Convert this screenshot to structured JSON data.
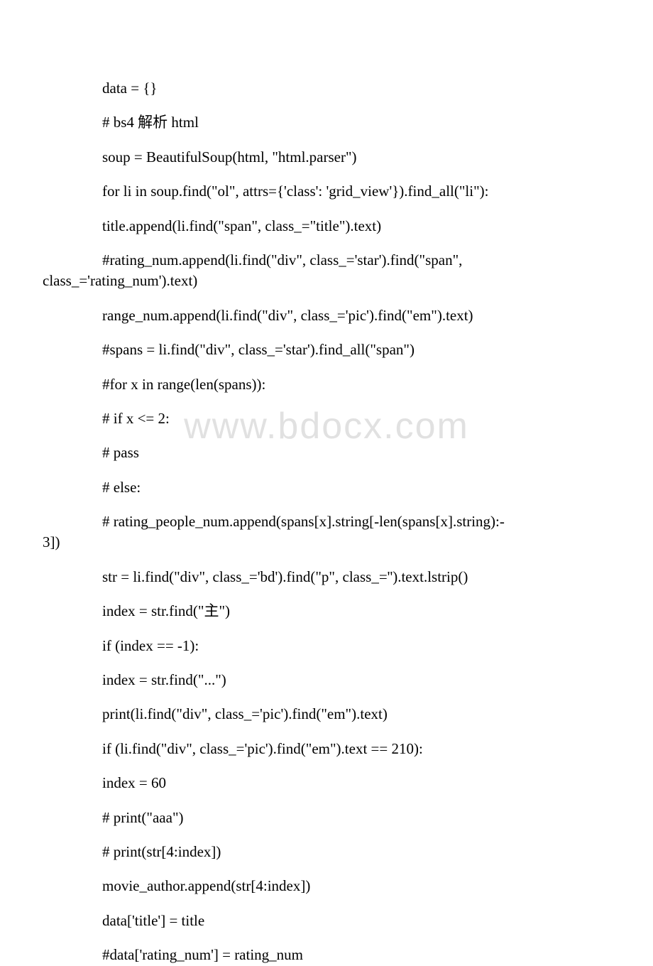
{
  "watermark": "www.bdocx.com",
  "lines": [
    {
      "text": "data = {}",
      "indent": true
    },
    {
      "text": "# bs4 解析 html",
      "indent": true
    },
    {
      "text": "soup = BeautifulSoup(html, \"html.parser\")",
      "indent": true
    },
    {
      "text": "for li in soup.find(\"ol\", attrs={'class': 'grid_view'}).find_all(\"li\"):",
      "indent": true
    },
    {
      "text": "title.append(li.find(\"span\", class_=\"title\").text)",
      "indent": true
    },
    {
      "text": "#rating_num.append(li.find(\"div\", class_='star').find(\"span\", class_='rating_num').text)",
      "indent": true,
      "wrap": true
    },
    {
      "text": "range_num.append(li.find(\"div\", class_='pic').find(\"em\").text)",
      "indent": true
    },
    {
      "text": "#spans = li.find(\"div\", class_='star').find_all(\"span\")",
      "indent": true
    },
    {
      "text": "#for x in range(len(spans)):",
      "indent": true
    },
    {
      "text": "# if x <= 2:",
      "indent": true
    },
    {
      "text": "# pass",
      "indent": true
    },
    {
      "text": "# else:",
      "indent": true
    },
    {
      "text": "# rating_people_num.append(spans[x].string[-len(spans[x].string):-3])",
      "indent": true,
      "wrap": true
    },
    {
      "text": "str = li.find(\"div\", class_='bd').find(\"p\", class_='').text.lstrip()",
      "indent": true
    },
    {
      "text": "index = str.find(\"主\")",
      "indent": true
    },
    {
      "text": "if (index == -1):",
      "indent": true
    },
    {
      "text": "index = str.find(\"...\")",
      "indent": true
    },
    {
      "text": "print(li.find(\"div\", class_='pic').find(\"em\").text)",
      "indent": true
    },
    {
      "text": "if (li.find(\"div\", class_='pic').find(\"em\").text == 210):",
      "indent": true
    },
    {
      "text": "index = 60",
      "indent": true
    },
    {
      "text": "# print(\"aaa\")",
      "indent": true
    },
    {
      "text": "# print(str[4:index])",
      "indent": true
    },
    {
      "text": "movie_author.append(str[4:index])",
      "indent": true
    },
    {
      "text": "data['title'] = title",
      "indent": true
    },
    {
      "text": "#data['rating_num'] = rating_num",
      "indent": true
    }
  ]
}
